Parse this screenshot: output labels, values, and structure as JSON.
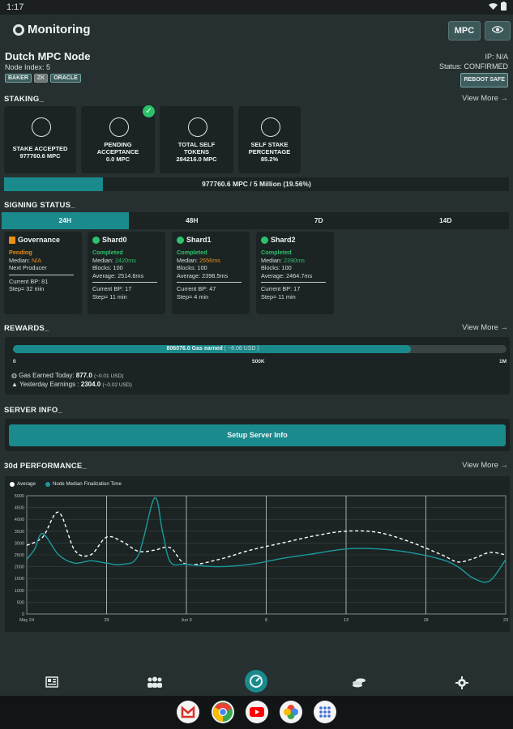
{
  "status_bar": {
    "time": "1:17"
  },
  "app_bar": {
    "title": "Monitoring",
    "mpc_button": "MPC"
  },
  "node": {
    "name": "Dutch MPC Node",
    "index": "Node Index: 5",
    "tags": [
      "BAKER",
      "ZK",
      "ORACLE"
    ],
    "ip": "IP: N/A",
    "status": "Status: CONFIRMED",
    "reboot_button": "REBOOT SAFE"
  },
  "staking": {
    "title": "STAKING_",
    "view_more": "View More →",
    "cards": [
      {
        "line1": "STAKE ACCEPTED",
        "line2": "977760.6 MPC"
      },
      {
        "line1": "PENDING",
        "line2": "ACCEPTANCE",
        "line3": "0.0 MPC"
      },
      {
        "line1": "TOTAL SELF",
        "line2": "TOKENS",
        "line3": "284216.0 MPC"
      },
      {
        "line1": "SELF STAKE",
        "line2": "PERCENTAGE",
        "line3": "85.2%"
      }
    ],
    "progress_text": "977760.6 MPC / 5 Million (19.56%)",
    "progress_fraction": 0.1956
  },
  "signing": {
    "title": "SIGNING STATUS_",
    "tabs": [
      "24H",
      "48H",
      "7D",
      "14D"
    ],
    "active_tab": "24H",
    "cards": [
      {
        "title": "Governance",
        "status": "Pending",
        "l1k": "Median: ",
        "l1v": "N/A",
        "l2": "Next Producer",
        "l3": "",
        "bp": "Current BP: 81",
        "step": "Step= 32 min"
      },
      {
        "title": "Shard0",
        "status": "Completed",
        "l1k": "Median: ",
        "l1v": "2420ms",
        "l2": "Blocks: 100",
        "l3": "Average: 2514.6ms",
        "bp": "Current BP: 17",
        "step": "Step= 11 min"
      },
      {
        "title": "Shard1",
        "status": "Completed",
        "l1k": "Median: ",
        "l1v": "2556ms",
        "l2": "Blocks: 100",
        "l3": "Average: 2398.5ms",
        "bp": "Current BP: 47",
        "step": "Step= 4 min"
      },
      {
        "title": "Shard2",
        "status": "Completed",
        "l1k": "Median: ",
        "l1v": "2390ms",
        "l2": "Blocks: 100",
        "l3": "Average: 2464.7ms",
        "bp": "Current BP: 17",
        "step": "Step= 11 min"
      }
    ]
  },
  "rewards": {
    "title": "REWARDS_",
    "view_more": "View More →",
    "bar_text": "806076.0 Gas earned",
    "bar_sub": "( ~8.06 USD )",
    "bar_fraction": 0.806,
    "scale": [
      "0",
      "500K",
      "1M"
    ],
    "today_label": "Gas Earned Today: ",
    "today_value": "877.0",
    "today_usd": "(~0.01 USD)",
    "yesterday_label": "Yesterday Earnings : ",
    "yesterday_value": "2304.0",
    "yesterday_usd": "(~0.02 USD)"
  },
  "server": {
    "title": "SERVER INFO_",
    "button": "Setup Server Info"
  },
  "performance": {
    "title": "30d PERFORMANCE_",
    "view_more": "View More →"
  },
  "chart_data": {
    "type": "line",
    "legend": [
      "Average",
      "Node Median Finalization Time"
    ],
    "ylim": [
      0,
      5000
    ],
    "yticks": [
      "5000",
      "4500",
      "4000",
      "3500",
      "3000",
      "2500",
      "2000",
      "1500",
      "1000",
      "500",
      "0"
    ],
    "xticks": [
      "May 24",
      "29",
      "Jun 3",
      "8",
      "13",
      "18",
      "23"
    ],
    "x_days": [
      0,
      5,
      10,
      15,
      20,
      25,
      30
    ],
    "series": [
      {
        "name": "Average",
        "color": "#ffffff",
        "dashed": true,
        "x": [
          0,
          1,
          2,
          3,
          4,
          5,
          6,
          7,
          8,
          9,
          10,
          12,
          14,
          16,
          18,
          20,
          22,
          24,
          26,
          27,
          28,
          29,
          30
        ],
        "values": [
          2900,
          3250,
          4300,
          2700,
          2500,
          3250,
          3050,
          2650,
          2700,
          2800,
          2100,
          2300,
          2700,
          3000,
          3300,
          3500,
          3450,
          3050,
          2500,
          2200,
          2350,
          2600,
          2500
        ]
      },
      {
        "name": "Node Median Finalization Time",
        "color": "#1a9a9c",
        "dashed": false,
        "x": [
          0,
          0.5,
          1,
          2,
          3,
          4,
          5,
          6,
          7,
          8,
          8.5,
          9,
          10,
          12,
          14,
          16,
          18,
          20,
          22,
          24,
          26,
          27,
          28,
          29,
          30
        ],
        "values": [
          2300,
          2750,
          3400,
          2500,
          2150,
          2250,
          2150,
          2100,
          2500,
          4900,
          3500,
          2200,
          2100,
          2000,
          2100,
          2350,
          2550,
          2750,
          2750,
          2600,
          2300,
          2000,
          1500,
          1400,
          2300
        ]
      }
    ]
  },
  "bottom_nav": {
    "icons": [
      "dashboard-icon",
      "nodes-icon",
      "monitoring-icon",
      "coins-icon",
      "gear-icon"
    ]
  },
  "dock": {
    "apps": [
      "gmail-icon",
      "chrome-icon",
      "youtube-icon",
      "photos-icon",
      "apps-icon"
    ]
  }
}
